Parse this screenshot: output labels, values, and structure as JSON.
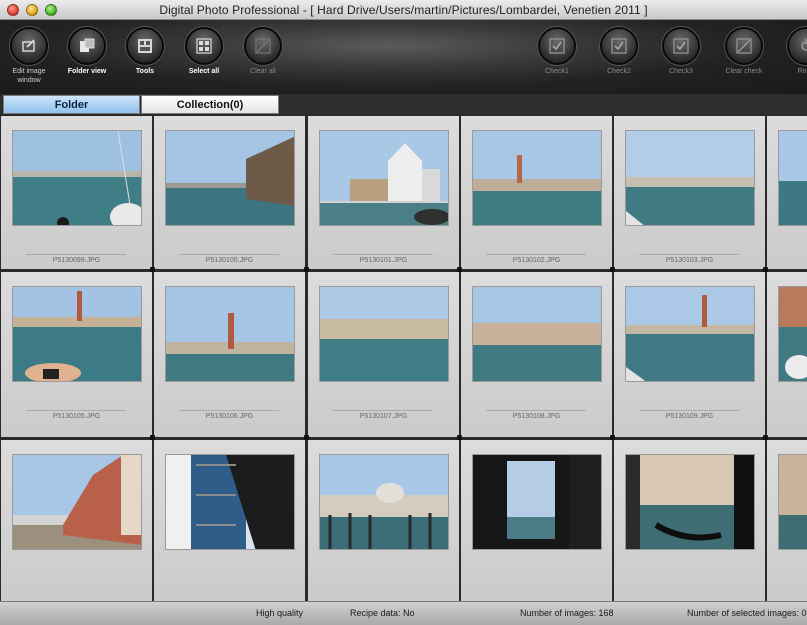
{
  "window": {
    "title": "Digital Photo Professional - [ Hard Drive/Users/martin/Pictures/Lombardei, Venetien 2011 ]"
  },
  "toolbar": {
    "edit_image_window": "Edit image window",
    "folder_view": "Folder view",
    "tools": "Tools",
    "select_all": "Select all",
    "clear_all": "Clear all",
    "check1": "Check1",
    "check2": "Check2",
    "check3": "Check3",
    "clear_check": "Clear check",
    "rotate": "Rotat"
  },
  "tabs": {
    "folder": "Folder",
    "collection": "Collection(0)"
  },
  "thumbnails": [
    {
      "filename": "P5130099.JPG"
    },
    {
      "filename": "P5130100.JPG"
    },
    {
      "filename": "P5130101.JPG"
    },
    {
      "filename": "P5130102.JPG"
    },
    {
      "filename": "P5130103.JPG"
    },
    {
      "filename": "P5130105.JPG"
    },
    {
      "filename": "P5130106.JPG"
    },
    {
      "filename": "P5130107.JPG"
    },
    {
      "filename": "P5130108.JPG"
    },
    {
      "filename": "P5130109.JPG"
    }
  ],
  "status": {
    "quality": "High quality",
    "recipe": "Recipe data: No",
    "num_images": "Number of images: 168",
    "num_selected": "Number of selected images: 0"
  },
  "colors": {
    "folder_tab": "#8fc0ec",
    "cell_bg": "#d4d4d4",
    "toolbar_bg": "#222222"
  }
}
